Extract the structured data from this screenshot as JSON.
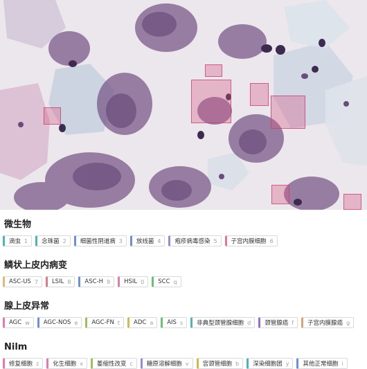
{
  "sections": [
    {
      "title": "微生物",
      "tags": [
        {
          "label": "滴虫",
          "key": "1",
          "color": "#4fb3bf"
        },
        {
          "label": "念珠菌",
          "key": "2",
          "color": "#4fb3bf"
        },
        {
          "label": "细菌性阴道病",
          "key": "3",
          "color": "#6e8fd6"
        },
        {
          "label": "放线菌",
          "key": "4",
          "color": "#6e8fd6"
        },
        {
          "label": "疱疹病毒感染",
          "key": "5",
          "color": "#9a8ad6"
        },
        {
          "label": "子宫内膜细胞",
          "key": "6",
          "color": "#e07a8a"
        }
      ]
    },
    {
      "title": "鳞状上皮内病变",
      "tags": [
        {
          "label": "ASC-US",
          "key": "7",
          "color": "#e0b97a"
        },
        {
          "label": "LSIL",
          "key": "8",
          "color": "#e07a8a"
        },
        {
          "label": "ASC-H",
          "key": "9",
          "color": "#6e8fd6"
        },
        {
          "label": "HSIL",
          "key": "0",
          "color": "#e07ab0"
        },
        {
          "label": "SCC",
          "key": "q",
          "color": "#6fbf73"
        }
      ]
    },
    {
      "title": "腺上皮异常",
      "tags": [
        {
          "label": "AGC",
          "key": "w",
          "color": "#e07ab0"
        },
        {
          "label": "AGC-NOS",
          "key": "e",
          "color": "#6e8fd6"
        },
        {
          "label": "AGC-FN",
          "key": "t",
          "color": "#9bbf5a"
        },
        {
          "label": "ADC",
          "key": "a",
          "color": "#d6b84a"
        },
        {
          "label": "AIS",
          "key": "s",
          "color": "#6fbf73"
        },
        {
          "label": "非典型颈管腺细胞",
          "key": "d",
          "color": "#4fb3bf"
        },
        {
          "label": "颈管腺癌",
          "key": "f",
          "color": "#9a6ad6"
        },
        {
          "label": "子宫内膜腺癌",
          "key": "g",
          "color": "#d6a47a"
        }
      ]
    },
    {
      "title": "Nilm",
      "tags": [
        {
          "label": "修复细胞",
          "key": "z",
          "color": "#e07ab0"
        },
        {
          "label": "化生细胞",
          "key": "x",
          "color": "#e07ab0"
        },
        {
          "label": "萎缩性改变",
          "key": "c",
          "color": "#9bbf5a"
        },
        {
          "label": "糖原溶解细胞",
          "key": "v",
          "color": "#9a8ad6"
        },
        {
          "label": "宫颈管细胞",
          "key": "b",
          "color": "#d6b84a"
        },
        {
          "label": "深染细胞团",
          "key": "y",
          "color": "#4fb3bf"
        },
        {
          "label": "其他正常细胞",
          "key": "i",
          "color": "#6e8fd6"
        }
      ]
    }
  ]
}
